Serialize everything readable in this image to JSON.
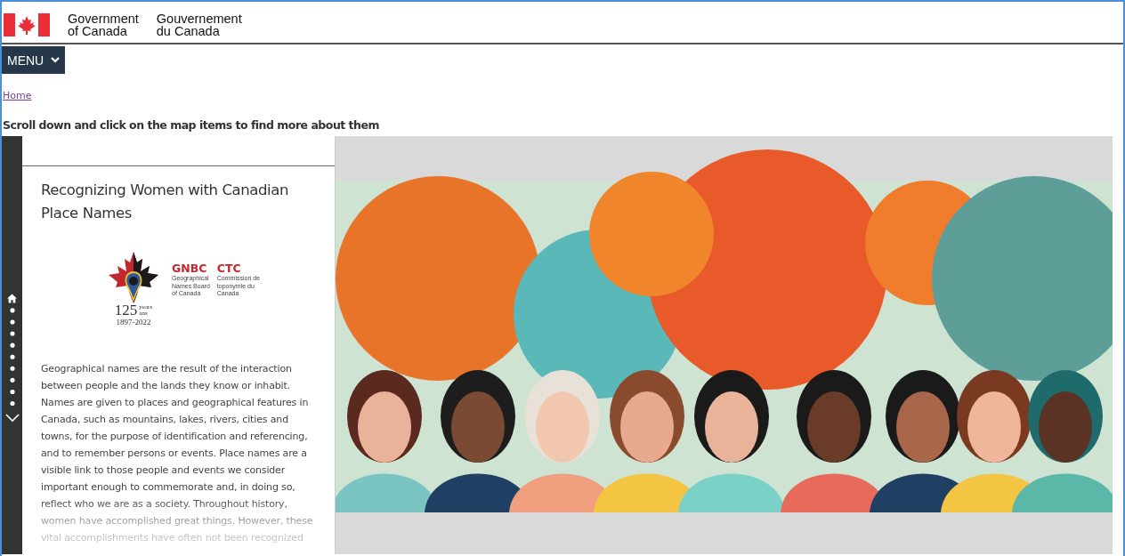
{
  "header": {
    "wordmark_en": [
      "Government",
      "of Canada"
    ],
    "wordmark_fr": [
      "Gouvernement",
      "du Canada"
    ]
  },
  "menu": {
    "label": "MENU"
  },
  "breadcrumb": [
    "Home"
  ],
  "instruction": "Scroll down and click on the map items to find more about them",
  "panel": {
    "title": "Recognizing Women with Canadian Place Names",
    "logo": {
      "acronym_en": "GNBC",
      "name_en": [
        "Geographical",
        "Names Board",
        "of Canada"
      ],
      "acronym_fr": "CTC",
      "name_fr": [
        "Commission de",
        "toponymie du",
        "Canada"
      ],
      "number": "125",
      "unit_en": "years",
      "unit_fr": "ans",
      "years": "1897-2022"
    },
    "body": "Geographical names are the result of the interaction between people and the lands they know or inhabit. Names are given to places and geographical features in Canada, such as mountains, lakes, rivers, cities and towns, for the purpose of identification and referencing, and to remember persons or events. Place names are a visible link to those people and events we consider important enough to commemorate and, in doing so, reflect who we are as a society. Throughout history, women have accomplished great things. However, these vital accomplishments have often not been recognized"
  },
  "illustration": {
    "kind": "picture"
  }
}
